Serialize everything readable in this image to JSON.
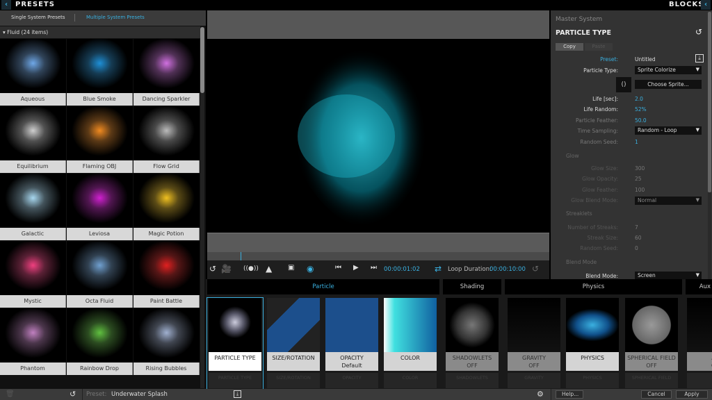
{
  "header": {
    "left_title": "PRESETS",
    "right_title": "BLOCKS"
  },
  "presets": {
    "tabs": [
      "Single System Presets",
      "Multiple System Presets"
    ],
    "active_tab": 1,
    "category": "Fluid (24 items)",
    "items": [
      {
        "label": "Aqueous",
        "color": "#6fa8e8"
      },
      {
        "label": "Blue Smoke",
        "color": "#1e8fd6"
      },
      {
        "label": "Dancing Sparkler",
        "color": "#d070e0"
      },
      {
        "label": "Equilibrium",
        "color": "#cfcfcf"
      },
      {
        "label": "Flaming OBJ",
        "color": "#f08a20"
      },
      {
        "label": "Flow Grid",
        "color": "#bbbbbb"
      },
      {
        "label": "Galactic",
        "color": "#a8d8f0"
      },
      {
        "label": "Leviosa",
        "color": "#d020d0"
      },
      {
        "label": "Magic Potion",
        "color": "#f0c020"
      },
      {
        "label": "Mystic",
        "color": "#f04080"
      },
      {
        "label": "Octa Fluid",
        "color": "#70a0d0"
      },
      {
        "label": "Paint Battle",
        "color": "#e02020"
      },
      {
        "label": "Phantom",
        "color": "#c080c0"
      },
      {
        "label": "Rainbow Drop",
        "color": "#60c040"
      },
      {
        "label": "Rising Bubbles",
        "color": "#a0b0d0"
      }
    ]
  },
  "transport": {
    "timecode": "00:00:01:02",
    "loop_label": "Loop Duration:",
    "loop_value": "00:00:10:00"
  },
  "inspector": {
    "system": "Master System",
    "title": "PARTICLE TYPE",
    "copy": "Copy",
    "paste": "Paste",
    "preset_label": "Preset:",
    "preset_value": "Untitled",
    "particle_type_label": "Particle Type:",
    "particle_type_value": "Sprite Colorize",
    "choose_sprite": "Choose Sprite...",
    "life_label": "Life [sec]:",
    "life_value": "2.0",
    "life_random_label": "Life Random:",
    "life_random_value": "52%",
    "feather_label": "Particle Feather:",
    "feather_value": "50.0",
    "time_sampling_label": "Time Sampling:",
    "time_sampling_value": "Random - Loop",
    "seed_label": "Random Seed:",
    "seed_value": "1",
    "glow_section": "Glow",
    "glow_size_label": "Glow Size:",
    "glow_size_value": "300",
    "glow_opacity_label": "Glow Opacity:",
    "glow_opacity_value": "25",
    "glow_feather_label": "Glow Feather:",
    "glow_feather_value": "100",
    "glow_blend_label": "Glow Blend Mode:",
    "glow_blend_value": "Normal",
    "streaklets_section": "Streaklets",
    "streaks_label": "Number of Streaks:",
    "streaks_value": "7",
    "streak_size_label": "Streak Size:",
    "streak_size_value": "60",
    "streak_seed_label": "Random Seed:",
    "streak_seed_value": "0",
    "blend_section": "Blend Mode",
    "blend_label": "Blend Mode:",
    "blend_value": "Screen"
  },
  "blocks": {
    "groups": [
      "Particle",
      "Shading",
      "Physics",
      "Aux"
    ],
    "cards": [
      {
        "label": "PARTICLE TYPE",
        "sub": "",
        "off": false
      },
      {
        "label": "SIZE/ROTATION",
        "sub": "",
        "off": false
      },
      {
        "label": "OPACITY",
        "sub": "Default",
        "off": false
      },
      {
        "label": "COLOR",
        "sub": "",
        "off": false
      },
      {
        "label": "SHADOWLETS",
        "sub": "OFF",
        "off": true
      },
      {
        "label": "GRAVITY",
        "sub": "OFF",
        "off": true
      },
      {
        "label": "PHYSICS",
        "sub": "",
        "off": false
      },
      {
        "label": "SPHERICAL FIELD",
        "sub": "OFF",
        "off": true
      },
      {
        "label": "A",
        "sub": "O",
        "off": true
      }
    ]
  },
  "footer": {
    "preset_label": "Preset:",
    "preset_value": "Underwater Splash",
    "help": "Help...",
    "cancel": "Cancel",
    "apply": "Apply"
  },
  "accent": "#3ab0e0"
}
